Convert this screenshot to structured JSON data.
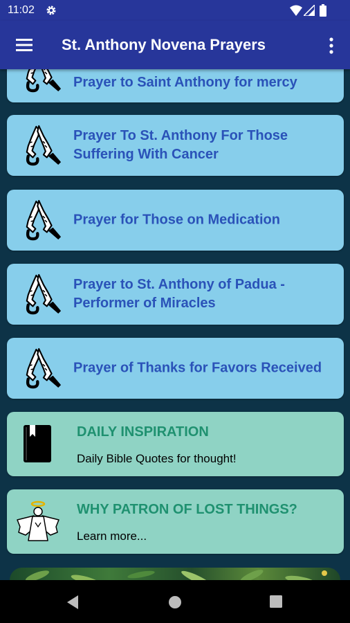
{
  "status_bar": {
    "time": "11:02"
  },
  "app_bar": {
    "title": "St. Anthony Novena Prayers",
    "icons": [
      "menu-icon",
      "more-vert-icon"
    ]
  },
  "prayers": [
    {
      "label": "Prayer to Saint Anthony for mercy",
      "icon": "praying-hands-icon"
    },
    {
      "label": "Prayer To St. Anthony For Those Suffering With Cancer",
      "icon": "praying-hands-icon"
    },
    {
      "label": "Prayer for Those on Medication",
      "icon": "praying-hands-icon"
    },
    {
      "label": "Prayer to St. Anthony of Padua - Performer of Miracles",
      "icon": "praying-hands-icon"
    },
    {
      "label": "Prayer of Thanks for Favors Received",
      "icon": "praying-hands-icon"
    }
  ],
  "daily_inspiration": {
    "title": "DAILY INSPIRATION",
    "subtitle": "Daily Bible Quotes for thought!",
    "icon": "bible-book-icon"
  },
  "lost_things": {
    "title": "WHY PATRON OF LOST THINGS?",
    "subtitle": "Learn more...",
    "icon": "angel-icon"
  },
  "colors": {
    "app_bar": "#27369a",
    "background": "#0d3347",
    "prayer_card": "#87ceeb",
    "prayer_text": "#2a52b8",
    "info_card": "#8fd3c4",
    "info_title": "#1f9170"
  }
}
